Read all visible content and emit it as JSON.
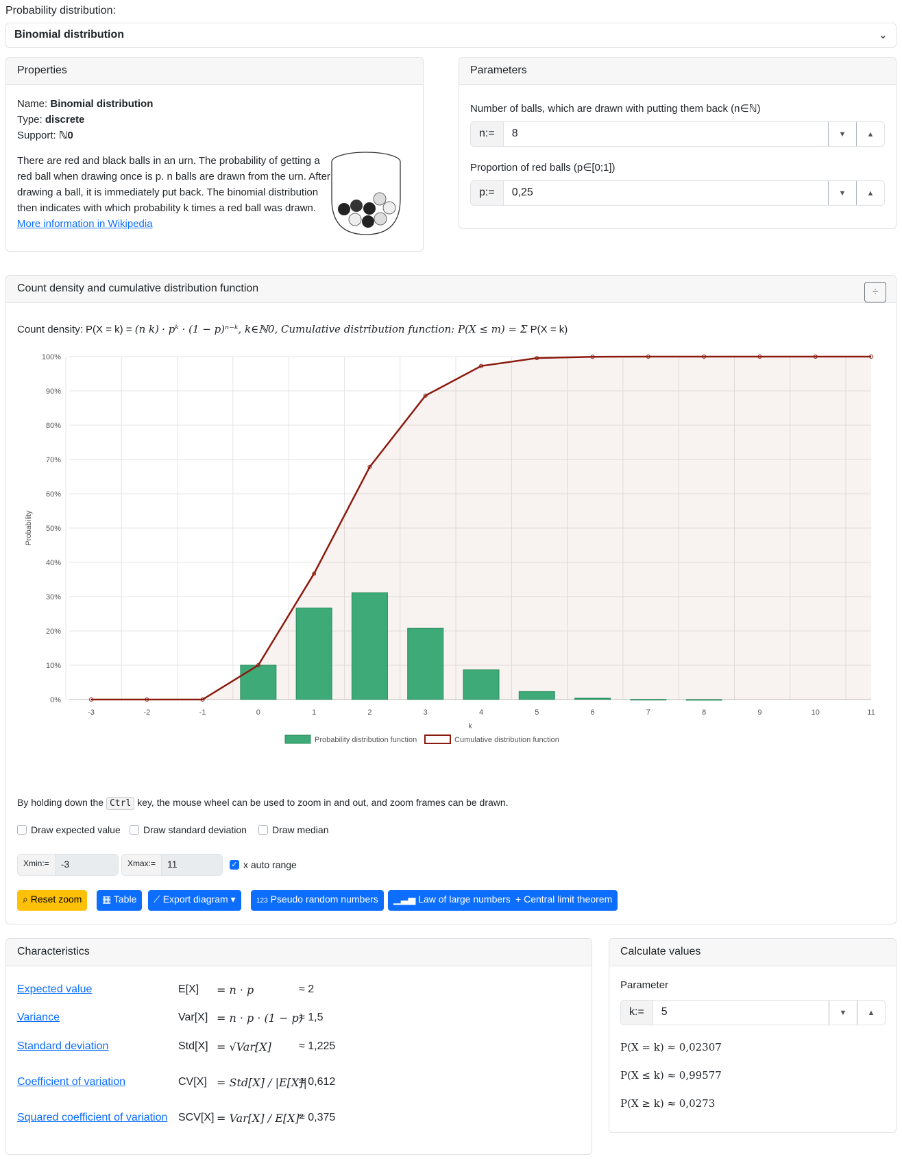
{
  "distribution_label": "Probability distribution:",
  "distribution_selected": "Binomial distribution",
  "properties": {
    "header": "Properties",
    "name_label": "Name:",
    "name_value": "Binomial distribution",
    "type_label": "Type:",
    "type_value": "discrete",
    "support_label": "Support:",
    "support_value": "ℕ0",
    "description_lines": [
      "There are red and black balls in an urn. The probability of getting a",
      "red ball when drawing once is p. n balls are drawn from the urn. After",
      "drawing a ball, it is immediately put back. The binomial distribution",
      "then indicates with which probability k times a red ball was drawn."
    ],
    "link": "More information in Wikipedia"
  },
  "parameters": {
    "header": "Parameters",
    "n_desc": "Number of balls, which are drawn with putting them back (n∈ℕ)",
    "n_prefix": "n:=",
    "n_value": "8",
    "p_desc": "Proportion of red balls (p∈[0;1])",
    "p_prefix": "p:=",
    "p_value": "0,25"
  },
  "chart_card": {
    "header": "Count density and cumulative distribution function",
    "formula": "Count density: P(X = k) = (n k) · pᵏ · (1 − p)ⁿ⁻ᵏ,  k∈ℕ0, Cumulative distribution function: P(X ≤ m) = Σ_{k=0}^{m} P(X = k)",
    "formula_a": "Count density: P(X = k) = ",
    "formula_b": "· pᵏ · (1 − p)ⁿ⁻ᵏ,  k∈ℕ0, Cumulative distribution function: P(X ≤ m) = ",
    "formula_c": " P(X = k)",
    "hint_a": "By holding down the",
    "hint_key": "Ctrl",
    "hint_b": "key, the mouse wheel can be used to zoom in and out, and zoom frames can be drawn.",
    "cb_expected": "Draw expected value",
    "cb_std": "Draw standard deviation",
    "cb_median": "Draw median",
    "xmin_prefix": "Xmin:=",
    "xmin_value": "-3",
    "xmax_prefix": "Xmax:=",
    "xmax_value": "11",
    "cb_auto": "x auto range",
    "buttons": {
      "reset": "Reset zoom",
      "table": "Table",
      "export": "Export diagram",
      "random": "Pseudo random numbers",
      "law": "Law of large numbers",
      "clt": "Central limit theorem"
    }
  },
  "chart_data": {
    "type": "bar",
    "xlabel": "k",
    "ylabel": "Probability",
    "x": [
      -3,
      -2,
      -1,
      0,
      1,
      2,
      3,
      4,
      5,
      6,
      7,
      8,
      9,
      10,
      11
    ],
    "ylim": [
      0,
      1
    ],
    "yticks": [
      "0%",
      "10%",
      "20%",
      "30%",
      "40%",
      "50%",
      "60%",
      "70%",
      "80%",
      "90%",
      "100%"
    ],
    "series": [
      {
        "name": "Probability distribution function",
        "type": "bar",
        "color": "#3daa78",
        "values": [
          0,
          0,
          0,
          0.1001,
          0.267,
          0.3115,
          0.2076,
          0.0865,
          0.0231,
          0.0038,
          0.0004,
          2e-05,
          0,
          0,
          0
        ]
      },
      {
        "name": "Cumulative distribution function",
        "type": "line",
        "color": "#8b1a0e",
        "values": [
          0,
          0,
          0,
          0.1001,
          0.3671,
          0.6785,
          0.8862,
          0.9727,
          0.9958,
          0.9996,
          1,
          1,
          1,
          1,
          1
        ]
      }
    ],
    "legend": "bottom",
    "grid": true
  },
  "characteristics": {
    "header": "Characteristics",
    "rows": [
      {
        "name": "Expected value",
        "sym": "E[X]",
        "formula": "= n · p",
        "approx": "≈ 2"
      },
      {
        "name": "Variance",
        "sym": "Var[X]",
        "formula": "= n · p · (1 − p)",
        "approx": "≈ 1,5"
      },
      {
        "name": "Standard deviation",
        "sym": "Std[X]",
        "formula": "= √Var[X]",
        "approx": "≈ 1,225"
      },
      {
        "name": "Coefficient of variation",
        "sym": "CV[X]",
        "formula": "= Std[X] / |E[X]|",
        "approx": "≈ 0,612"
      },
      {
        "name": "Squared coefficient of variation",
        "sym": "SCV[X]",
        "formula": "= Var[X] / E[X]²",
        "approx": "≈ 0,375"
      }
    ]
  },
  "calc": {
    "header": "Calculate values",
    "param_label": "Parameter",
    "k_prefix": "k:=",
    "k_value": "5",
    "r1": "P(X = k) ≈ 0,02307",
    "r2": "P(X ≤ k) ≈ 0,99577",
    "r3": "P(X ≥ k) ≈ 0,0273"
  }
}
